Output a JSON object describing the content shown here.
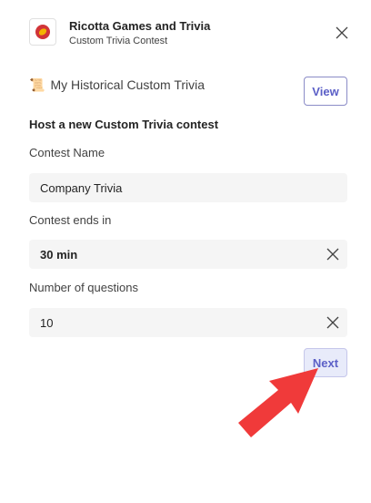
{
  "header": {
    "app_name": "Ricotta Games and Trivia",
    "subtitle": "Custom Trivia Contest",
    "logo_icon": "ricotta-logo-icon",
    "close_icon": "close-icon"
  },
  "history": {
    "icon": "scroll-icon",
    "icon_glyph": "📜",
    "label": "My Historical Custom Trivia",
    "view_label": "View"
  },
  "form": {
    "title": "Host a new Custom Trivia contest",
    "contest_name": {
      "label": "Contest Name",
      "value": "Company Trivia"
    },
    "contest_ends": {
      "label": "Contest ends in",
      "value": "30 min"
    },
    "num_questions": {
      "label": "Number of questions",
      "value": "10"
    },
    "next_label": "Next"
  },
  "colors": {
    "brand": "#5b5fc7",
    "field_background": "#f5f5f5",
    "next_background": "#e8ebfa",
    "logo_red": "#d13438",
    "logo_yellow": "#f4b400",
    "annotation_arrow": "#f03a3a"
  },
  "annotation": {
    "arrow_icon": "pointer-arrow-icon",
    "target": "Next"
  }
}
